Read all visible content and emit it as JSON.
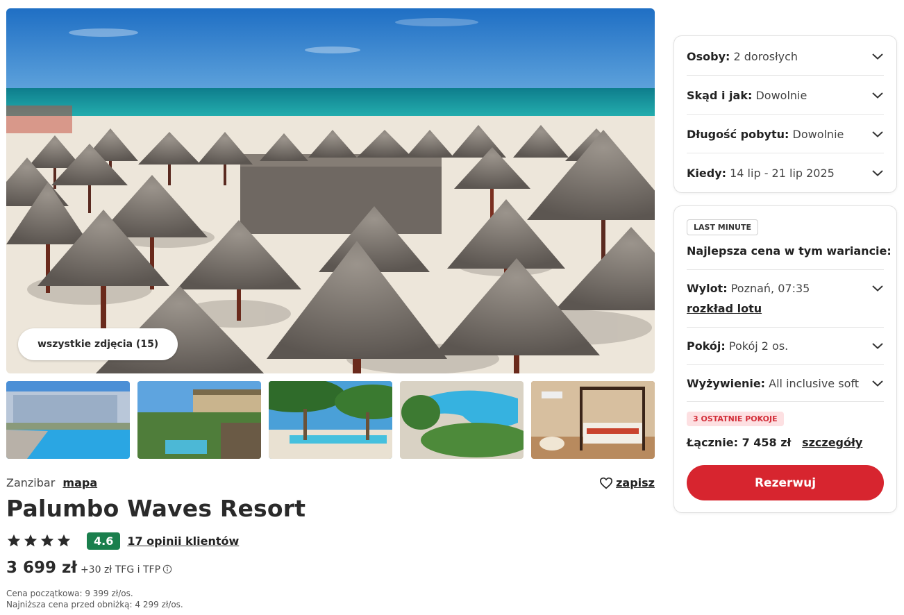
{
  "gallery": {
    "all_photos_label": "wszystkie zdjęcia (15)"
  },
  "hotel": {
    "location": "Zanzibar",
    "map_link": "mapa",
    "save_label": "zapisz",
    "name": "Palumbo Waves Resort",
    "stars": 4,
    "rating": "4.6",
    "reviews_link": "17 opinii klientów",
    "price": "3 699 zł",
    "price_extra": "+30 zł TFG i TFP",
    "initial_price": "Cena początkowa: 9 399 zł/os.",
    "lowest_price": "Najniższa cena przed obniżką: 4 299 zł/os."
  },
  "search_panel": {
    "rows": [
      {
        "label": "Osoby:",
        "value": "2 dorosłych"
      },
      {
        "label": "Skąd i jak:",
        "value": "Dowolnie"
      },
      {
        "label": "Długość pobytu:",
        "value": "Dowolnie"
      },
      {
        "label": "Kiedy:",
        "value": "14 lip - 21 lip 2025"
      }
    ]
  },
  "offer_panel": {
    "badge": "LAST MINUTE",
    "best_price_title": "Najlepsza cena w tym wariancie:",
    "flight": {
      "label": "Wylot:",
      "value": "Poznań, 07:35",
      "link": "rozkład lotu"
    },
    "room": {
      "label": "Pokój:",
      "value": "Pokój 2 os."
    },
    "board": {
      "label": "Wyżywienie:",
      "value": "All inclusive soft"
    },
    "rooms_left_badge": "3 OSTATNIE POKOJE",
    "total_label": "Łącznie: 7 458 zł",
    "details_link": "szczegóły",
    "book_button": "Rezerwuj"
  },
  "colors": {
    "book_button": "#d7252f",
    "rating_badge": "#1a7f4d",
    "urgent_badge_bg": "#fde0e2",
    "urgent_badge_text": "#d32f3a"
  }
}
